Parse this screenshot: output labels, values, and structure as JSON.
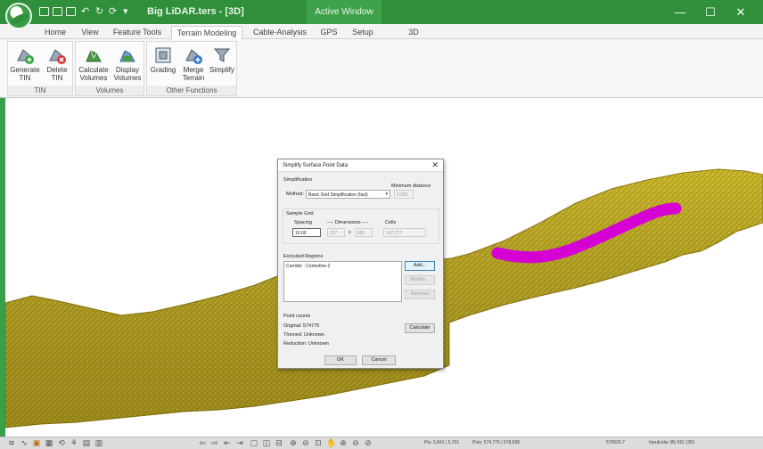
{
  "window": {
    "title": "Big LiDAR.ters - [3D]",
    "active_window_label": "Active Window",
    "minimize": "—",
    "maximize": "☐",
    "close": "✕"
  },
  "tabs": [
    {
      "label": "Home"
    },
    {
      "label": "View"
    },
    {
      "label": "Feature Tools"
    },
    {
      "label": "Terrain Modeling",
      "active": true
    },
    {
      "label": "Cable-Analysis"
    },
    {
      "label": "GPS"
    },
    {
      "label": "Setup"
    },
    {
      "label": "3D"
    }
  ],
  "ribbon": {
    "groups": [
      {
        "label": "TIN",
        "buttons": [
          {
            "line1": "Generate",
            "line2": "TIN",
            "icon": "generate-tin-icon"
          },
          {
            "line1": "Delete",
            "line2": "TIN",
            "icon": "delete-tin-icon"
          }
        ]
      },
      {
        "label": "Volumes",
        "buttons": [
          {
            "line1": "Calculate",
            "line2": "Volumes",
            "icon": "calculate-volumes-icon"
          },
          {
            "line1": "Display",
            "line2": "Volumes",
            "icon": "display-volumes-icon"
          }
        ]
      },
      {
        "label": "Other Functions",
        "buttons": [
          {
            "line1": "Grading",
            "line2": "",
            "icon": "grading-icon"
          },
          {
            "line1": "Merge",
            "line2": "Terrain",
            "icon": "merge-terrain-icon"
          },
          {
            "line1": "Simplify",
            "line2": "",
            "icon": "simplify-icon"
          }
        ]
      }
    ]
  },
  "dialog": {
    "title": "Simplify Surface Point Data",
    "simplification_label": "Simplification",
    "method_label": "Method:",
    "method_value": "Basic Grid Simplification (fast)",
    "min_distance_label": "Minimum distance",
    "min_distance_value": "0.300",
    "sample_grid_label": "Sample Grid",
    "spacing_label": "Spacing",
    "spacing_value": "10.00",
    "dimensions_label": "---- Dimensions ----",
    "dim_x": "227",
    "dim_sep": "x",
    "dim_y": "651",
    "cells_label": "Cells",
    "cells_value": "147,777",
    "excluded_label": "Excluded Regions",
    "excluded_items": [
      "Corridor : Centerline-2"
    ],
    "add_button": "Add...",
    "modify_button": "Modify...",
    "remove_button": "Remove",
    "point_counts_label": "Point counts",
    "original": "Original: 574775",
    "thinned": "Thinned: Unknown",
    "reduction": "Reduction: Unknown",
    "calculate_button": "Calculate",
    "ok_button": "OK",
    "cancel_button": "Cancel"
  },
  "statusbar": {
    "pts1": "Pts: 5,841 | 5,701",
    "pts2": "Pnts: 574,775 | 578,598",
    "coord": "579529.7",
    "layer": "InputLidar (B) 651 (3D)"
  },
  "colors": {
    "titlebar": "#2f8f3a",
    "terrain": "#c9b52a",
    "corridor": "#d400d4"
  }
}
